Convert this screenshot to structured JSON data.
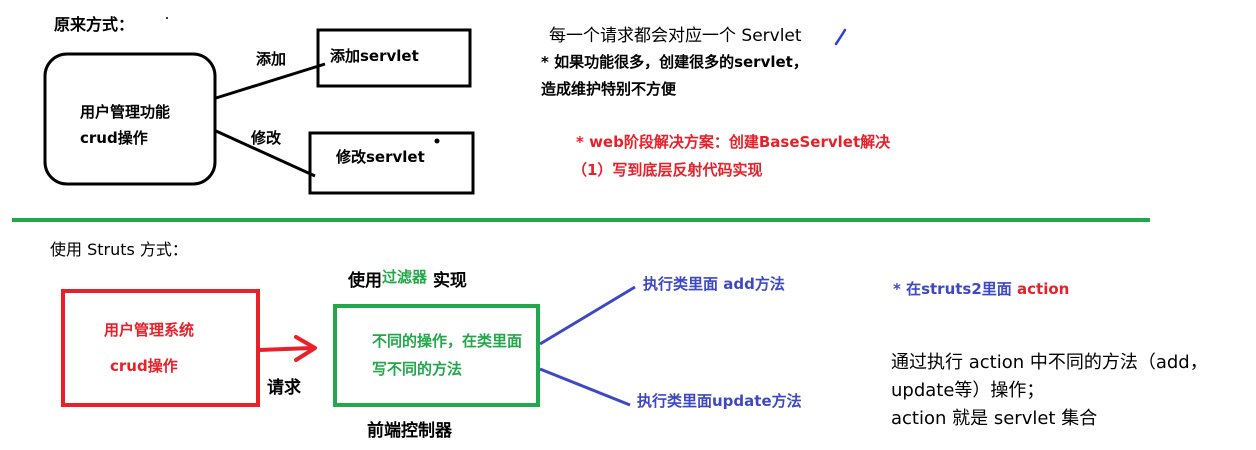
{
  "top": {
    "heading": "原来方式：",
    "box_main": {
      "line1": "用户管理功能",
      "line2": "crud操作"
    },
    "edge_add_label": "添加",
    "edge_edit_label": "修改",
    "box_add": "添加servlet",
    "box_edit": "修改servlet",
    "note_title": "每一个请求都会对应一个 Servlet",
    "note_line1": "* 如果功能很多，创建很多的servlet，",
    "note_line2": "造成维护特别不方便",
    "solution_line1": "* web阶段解决方案：创建BaseServlet解决",
    "solution_line2": "（1）写到底层反射代码实现"
  },
  "bottom": {
    "heading": "使用 Struts 方式：",
    "system_box": {
      "line1": "用户管理系统",
      "line2": "crud操作"
    },
    "request_label": "请求",
    "filter_prefix": "使用",
    "filter_word": "过滤器",
    "filter_suffix": "实现",
    "controller_box": {
      "line1": "不同的操作，在类里面",
      "line2": "写不同的方法"
    },
    "controller_caption": "前端控制器",
    "branch_add": "执行类里面 add方法",
    "branch_update": "执行类里面update方法",
    "struts_note_prefix": "* 在struts2里面",
    "struts_note_action": "action",
    "summary_line1": "通过执行 action 中不同的方法（add，",
    "summary_line2": "update等）操作；",
    "summary_line3": "action 就是 servlet 集合"
  },
  "colors": {
    "red": "#e8202a",
    "green": "#22a84a",
    "blue": "#3d48c4",
    "divider": "#22a84a",
    "pen_mark": "#2b3fd6"
  }
}
